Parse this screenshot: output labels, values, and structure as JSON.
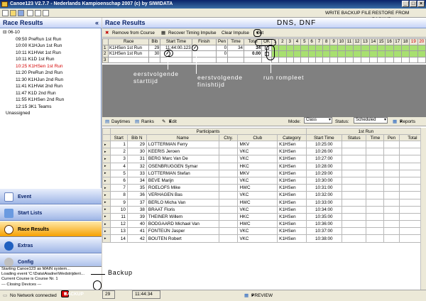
{
  "window": {
    "title": "Canoe123 V2.7.7  -  Nederlands Kampioenschap 2007       (c) by SIWIDATA"
  },
  "toolbar": {
    "write_backup": "WRITE BACKUP FILE",
    "restore_backup": "RESTORE FROM BACKUP"
  },
  "left": {
    "title": "Race Results",
    "collapse": "«",
    "date": "06-10",
    "runs": [
      "09:50 PreRun 1st Run",
      "10:00 K1HJun 1st Run",
      "10:11 K1HVet 1st Run",
      "10:11 K1D 1st Run",
      "10:25 K1HSen 1st Run",
      "11:20 PreRun 2nd Run",
      "11:30 K1HJun 2nd Run",
      "11:41 K1HVet 2nd Run",
      "11:47 K1D 2nd Run",
      "11:55 K1HSen 2nd Run",
      "12:15 3K1 Teams"
    ],
    "active_run_index": 4,
    "unassigned": "Unassigned",
    "nav": [
      "Event",
      "Start Lists",
      "Race Results",
      "Extras",
      "Config"
    ],
    "active_nav_index": 2,
    "nav_more": "»",
    "log": [
      "Starting Canoe123 as MAIN system...",
      "Loading event 'C:\\Data\\Aiadne\\Wedstrijden\\...",
      "Current Course is Course Nr. 1",
      "--- Closing Devices ---"
    ]
  },
  "main": {
    "title": "Race Results",
    "annotation_dns": "DNS, DNF",
    "actions": {
      "remove": "Remove from Course",
      "recover": "Recover Timing Impulse",
      "clear": "Clear Impulse",
      "out": "Out"
    },
    "race_grid": {
      "headers": [
        "Race",
        "Bib",
        "Start Time",
        "Finish",
        "Pen",
        "Time",
        "Total",
        "OK"
      ],
      "gates": [
        "1",
        "2",
        "3",
        "4",
        "5",
        "6",
        "7",
        "8",
        "9",
        "10",
        "11",
        "12",
        "13",
        "14",
        "15",
        "16",
        "17",
        "18",
        "19",
        "20"
      ],
      "red_gates": [
        "19",
        "20"
      ],
      "rows": [
        {
          "idx": "1",
          "race": "K1HSen 1st Run",
          "bib": "29",
          "start": "11:44:00.123",
          "finish": "",
          "pen": "0",
          "time": "34",
          "total": "34",
          "green_count": 18
        },
        {
          "idx": "2",
          "race": "K1HSen 1st Run",
          "bib": "30",
          "start": "",
          "finish": "",
          "pen": "0",
          "time": "",
          "total": "0.00",
          "green_count": 18
        },
        {
          "idx": "3",
          "race": "",
          "bib": "",
          "start": "",
          "finish": "",
          "pen": "",
          "time": "",
          "total": "",
          "green_count": 0
        }
      ]
    },
    "annotations": {
      "start": "eerstvolgende\nstarttijd",
      "finish": "eerstvolgende\nfinishtijd",
      "complete": "run rompleet"
    },
    "results_toolbar": {
      "daytimes": "Daytimes",
      "ranks": "Ranks",
      "edit": "Edit",
      "mode_label": "Mode:",
      "mode_value": "Class",
      "status_label": "Status:",
      "status_value": "Scheduled",
      "reports": "Reports"
    },
    "results": {
      "group_participants": "Participants",
      "group_run": "1st Run",
      "headers": [
        "Start",
        "Bib N",
        "Name",
        "Ctry.",
        "Club",
        "Category",
        "Start Time",
        "Status",
        "Time",
        "Pen",
        "Total"
      ],
      "rows": [
        [
          "1",
          "29",
          "LOTTERMAN Ferry",
          "",
          "MKV",
          "K1HSen",
          "10:25:00"
        ],
        [
          "2",
          "30",
          "KEERIS Jeroen",
          "",
          "VKC",
          "K1HSen",
          "10:26:00"
        ],
        [
          "3",
          "31",
          "BERG Marc Van De",
          "",
          "VKC",
          "K1HSen",
          "10:27:00"
        ],
        [
          "4",
          "32",
          "OSENBRUGGEN Symar",
          "",
          "HKC",
          "K1HSen",
          "10:28:00"
        ],
        [
          "5",
          "33",
          "LOTTERMAN Stefan",
          "",
          "MKV",
          "K1HSen",
          "10:29:00"
        ],
        [
          "6",
          "34",
          "BEVE Marijn",
          "",
          "VKC",
          "K1HSen",
          "10:30:00"
        ],
        [
          "7",
          "35",
          "ROELOFS Mike",
          "",
          "HWC",
          "K1HSen",
          "10:31:00"
        ],
        [
          "8",
          "36",
          "VERHAGEN Bas",
          "",
          "VKC",
          "K1HSen",
          "10:32:00"
        ],
        [
          "9",
          "37",
          "BERLO Micha Van",
          "",
          "HWC",
          "K1HSen",
          "10:33:00"
        ],
        [
          "10",
          "38",
          "BRAAT Floris",
          "",
          "VKC",
          "K1HSen",
          "10:34:00"
        ],
        [
          "11",
          "39",
          "THEINER Willem",
          "",
          "HKC",
          "K1HSen",
          "10:35:00"
        ],
        [
          "12",
          "40",
          "BODGAARD Michael Van",
          "",
          "HWC",
          "K1HSen",
          "10:36:00"
        ],
        [
          "13",
          "41",
          "FONTEIJN Jasper",
          "",
          "VKC",
          "K1HSen",
          "10:37:00"
        ],
        [
          "14",
          "42",
          "BOUTEN Robert",
          "",
          "VKC",
          "K1HSen",
          "10:38:00"
        ]
      ]
    }
  },
  "status": {
    "network": "No Network connected",
    "backup_label": "BACKUP",
    "backup_annotation": "Backup",
    "bib": "29",
    "time": "11:44:34",
    "preview": "PREVIEW"
  },
  "colors": {
    "gate_green": "#a8e070",
    "gate_red": "#ff9a9a",
    "active_run": "#d40000",
    "active_nav": "#f6a000"
  }
}
